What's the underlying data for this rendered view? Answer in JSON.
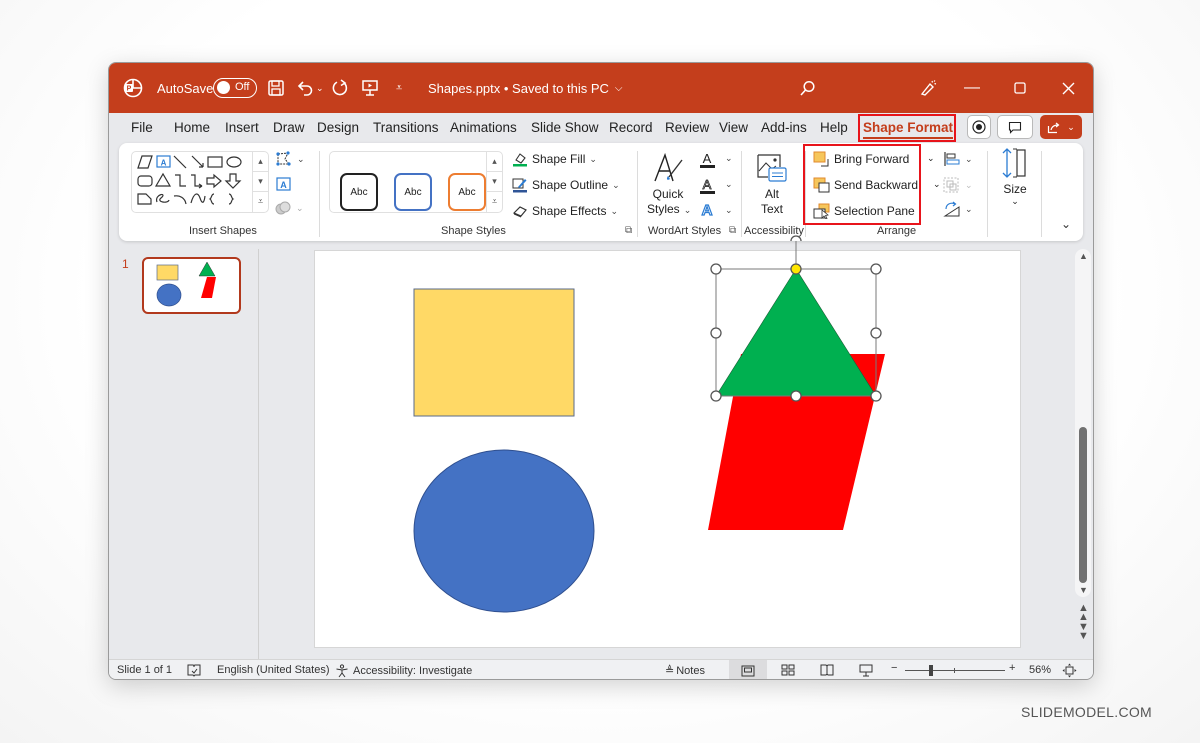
{
  "titlebar": {
    "autosave_label": "AutoSave",
    "autosave_state": "Off",
    "doc_title": "Shapes.pptx • Saved to this PC",
    "icons": [
      "powerpoint-logo-icon",
      "save-icon",
      "undo-icon",
      "redo-icon",
      "present-icon",
      "customize-qat-icon",
      "search-icon",
      "designer-icon",
      "minimize-icon",
      "maximize-icon",
      "close-icon"
    ]
  },
  "tabs": [
    {
      "label": "File"
    },
    {
      "label": "Home"
    },
    {
      "label": "Insert"
    },
    {
      "label": "Draw"
    },
    {
      "label": "Design"
    },
    {
      "label": "Transitions"
    },
    {
      "label": "Animations"
    },
    {
      "label": "Slide Show"
    },
    {
      "label": "Record"
    },
    {
      "label": "Review"
    },
    {
      "label": "View"
    },
    {
      "label": "Add-ins"
    },
    {
      "label": "Help"
    },
    {
      "label": "Shape Format",
      "active": true
    }
  ],
  "ribbon": {
    "insert_shapes": {
      "label": "Insert Shapes"
    },
    "shape_styles": {
      "label": "Shape Styles",
      "presets": [
        {
          "text": "Abc",
          "color": "#222222"
        },
        {
          "text": "Abc",
          "color": "#4472c4"
        },
        {
          "text": "Abc",
          "color": "#ed7d31"
        }
      ],
      "shape_fill": "Shape Fill",
      "shape_outline": "Shape Outline",
      "shape_effects": "Shape Effects"
    },
    "wordart": {
      "label": "WordArt Styles",
      "quick_styles_line1": "Quick",
      "quick_styles_line2": "Styles"
    },
    "accessibility": {
      "label": "Accessibility",
      "alt_text_line1": "Alt",
      "alt_text_line2": "Text"
    },
    "arrange": {
      "label": "Arrange",
      "bring_forward": "Bring Forward",
      "send_backward": "Send Backward",
      "selection_pane": "Selection Pane"
    },
    "size": {
      "label": "Size"
    }
  },
  "thumbnails": [
    {
      "number": "1"
    }
  ],
  "slide": {
    "shapes": [
      {
        "type": "rectangle",
        "fill": "#ffd966",
        "stroke": "#5a6a8a"
      },
      {
        "type": "ellipse",
        "fill": "#4472c4",
        "stroke": "#2f4f8f"
      },
      {
        "type": "parallelogram",
        "fill": "#ff0000"
      },
      {
        "type": "triangle",
        "fill": "#00b050",
        "selected": true
      }
    ]
  },
  "statusbar": {
    "slide_info": "Slide 1 of 1",
    "language": "English (United States)",
    "accessibility": "Accessibility: Investigate",
    "notes": "Notes",
    "zoom_level": "56%",
    "zoom_value_percent": 56
  },
  "watermark": "SLIDEMODEL.COM",
  "colors": {
    "accent": "#c43e1c",
    "highlight": "#e8141b"
  }
}
